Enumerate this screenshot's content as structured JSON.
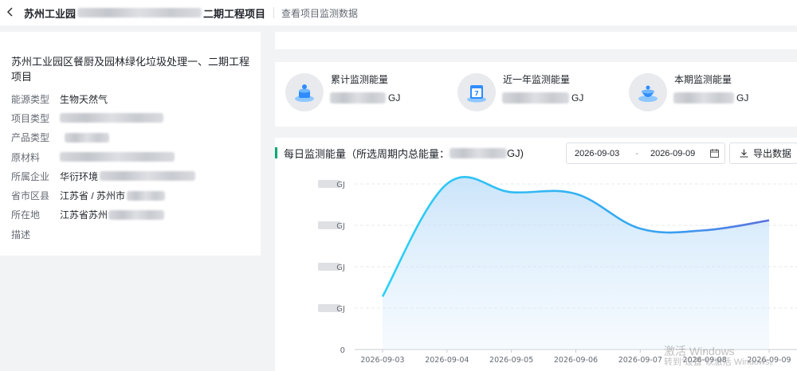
{
  "header": {
    "back_icon": "chevron-left-icon",
    "title_prefix": "苏州工业园",
    "title_suffix": "二期工程项目",
    "subtitle": "查看项目监测数据"
  },
  "project": {
    "title": "苏州工业园区餐厨及园林绿化垃圾处理一、二期工程项目",
    "fields": [
      {
        "label": "能源类型",
        "value": "生物天然气"
      },
      {
        "label": "项目类型",
        "value": ""
      },
      {
        "label": "产品类型",
        "value": ""
      },
      {
        "label": "原材料",
        "value": ""
      },
      {
        "label": "所属企业",
        "value": "华衍环境"
      },
      {
        "label": "省市区县",
        "value": "江苏省 / 苏州市"
      },
      {
        "label": "所在地",
        "value": "江苏省苏州"
      },
      {
        "label": "描述",
        "value": ""
      }
    ]
  },
  "stats": [
    {
      "label": "累计监测能量",
      "unit": "GJ",
      "icon": "cumulative-energy-icon"
    },
    {
      "label": "近一年监测能量",
      "unit": "GJ",
      "icon": "calendar-energy-icon"
    },
    {
      "label": "本期监测能量",
      "unit": "GJ",
      "icon": "period-energy-icon"
    }
  ],
  "chart_section": {
    "title": "每日监测能量（所选周期内总能量：",
    "title_unit": "GJ)",
    "date_start": "2026-09-03",
    "date_sep": "-",
    "date_end": "2026-09-09",
    "export_label": "导出数据",
    "accent_color": "#00a870"
  },
  "chart_data": {
    "type": "area",
    "x": [
      "2026-09-03",
      "2026-09-04",
      "2026-09-05",
      "2026-09-06",
      "2026-09-07",
      "2026-09-08",
      "2026-09-09"
    ],
    "series": [
      {
        "values": [
          0.32,
          1.0,
          0.95,
          0.94,
          0.73,
          0.72,
          0.78
        ]
      }
    ],
    "y_tick_labels": [
      "GJ",
      "GJ",
      "GJ",
      "GJ",
      "0"
    ],
    "grid": true,
    "line_gradient": [
      "#2ad2f5",
      "#5b6fe0"
    ]
  },
  "watermark": {
    "line1": "激活 Windows",
    "line2": "转到\"设置\"以激活 Windows。"
  }
}
